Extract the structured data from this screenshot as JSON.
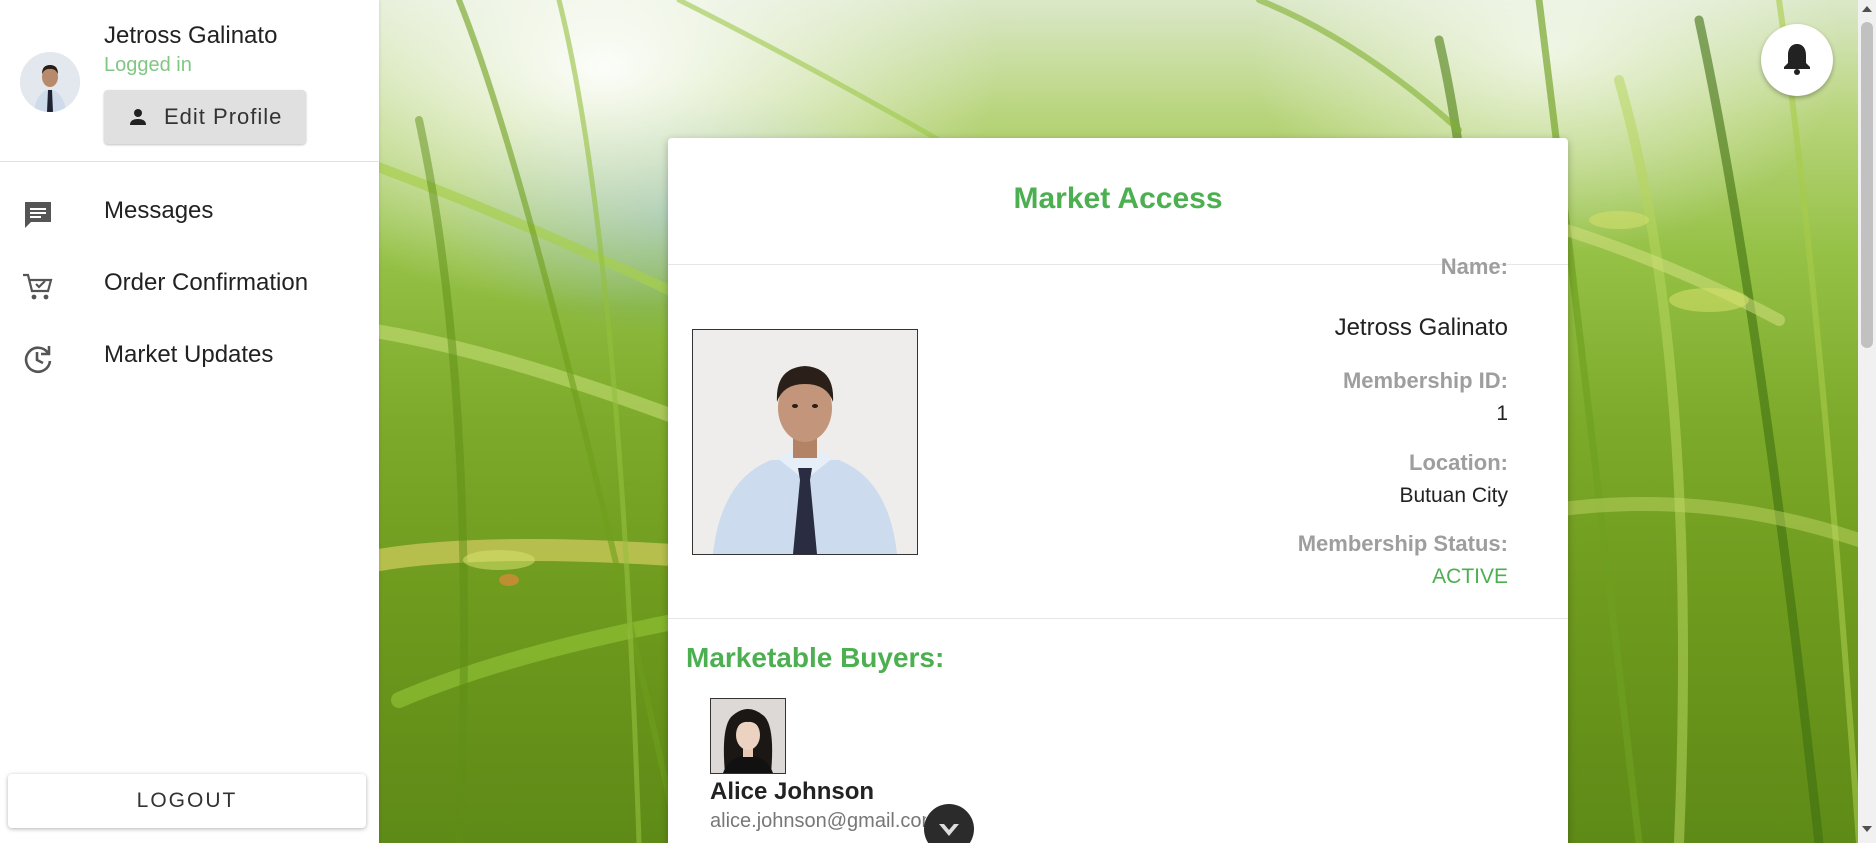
{
  "sidebar": {
    "user": {
      "name": "Jetross Galinato",
      "status": "Logged in",
      "edit_profile_label": "Edit Profile"
    },
    "nav_items": [
      {
        "label": "Messages",
        "icon": "message-icon"
      },
      {
        "label": "Order Confirmation",
        "icon": "cart-icon"
      },
      {
        "label": "Market Updates",
        "icon": "update-icon"
      }
    ],
    "logout_label": "LOGOUT"
  },
  "header": {
    "notification_icon": "bell-icon"
  },
  "card": {
    "title": "Market Access",
    "profile": {
      "name_label": "Name:",
      "name_value": "Jetross Galinato",
      "membership_id_label": "Membership ID:",
      "membership_id_value": "1",
      "location_label": "Location:",
      "location_value": "Butuan City",
      "status_label": "Membership Status:",
      "status_value": "ACTIVE"
    },
    "buyers_title": "Marketable Buyers:",
    "buyers": [
      {
        "name": "Alice Johnson",
        "email": "alice.johnson@gmail.com"
      }
    ]
  },
  "colors": {
    "accent_green": "#4caf50",
    "status_green": "#81c784",
    "label_gray": "#9e9e9e"
  }
}
